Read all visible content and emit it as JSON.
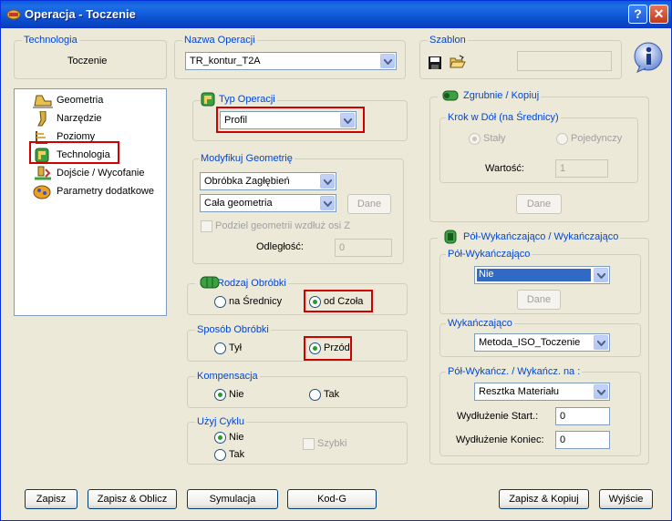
{
  "window": {
    "title": "Operacja - Toczenie",
    "help_label": "?",
    "close_label": "✕"
  },
  "technologia": {
    "legend": "Technologia",
    "value": "Toczenie"
  },
  "nazwa_operacji": {
    "legend": "Nazwa Operacji",
    "value": "TR_kontur_T2A"
  },
  "szablon": {
    "legend": "Szablon",
    "value": ""
  },
  "tree": {
    "items": [
      {
        "label": "Geometria",
        "icon": "geometry-icon"
      },
      {
        "label": "Narzędzie",
        "icon": "tool-icon"
      },
      {
        "label": "Poziomy",
        "icon": "levels-icon"
      },
      {
        "label": "Technologia",
        "icon": "technology-icon"
      },
      {
        "label": "Dojście / Wycofanie",
        "icon": "approach-icon"
      },
      {
        "label": "Parametry dodatkowe",
        "icon": "params-icon"
      }
    ]
  },
  "typ_operacji": {
    "legend": "Typ Operacji",
    "value": "Profil"
  },
  "modyfikuj": {
    "legend": "Modyfikuj Geometrię",
    "combo1": "Obróbka Zagłębień",
    "combo2": "Cała geometria",
    "dane_label": "Dane",
    "check_label": "Podziel geometrii wzdłuż osi Z",
    "odleglosc_label": "Odległość:",
    "odleglosc_value": "0"
  },
  "rodzaj": {
    "legend": "Rodzaj Obróbki",
    "opt1": "na Średnicy",
    "opt2": "od Czoła"
  },
  "sposob": {
    "legend": "Sposób Obróbki",
    "opt1": "Tył",
    "opt2": "Przód"
  },
  "kompensacja": {
    "legend": "Kompensacja",
    "opt1": "Nie",
    "opt2": "Tak"
  },
  "uzyj_cyklu": {
    "legend": "Użyj Cyklu",
    "opt1": "Nie",
    "opt2": "Tak",
    "check_label": "Szybki"
  },
  "zgrubnie": {
    "legend": "Zgrubnie / Kopiuj",
    "krok_legend": "Krok w Dół (na Średnicy)",
    "opt1": "Stały",
    "opt2": "Pojedynczy",
    "wartosc_label": "Wartość:",
    "wartosc_value": "1",
    "dane_label": "Dane"
  },
  "polwyk": {
    "legend": "Pół-Wykańczająco / Wykańczająco",
    "pol_legend": "Pół-Wykańczająco",
    "pol_value": "Nie",
    "dane_label": "Dane",
    "wyk_legend": "Wykańczająco",
    "wyk_value": "Metoda_ISO_Toczenie",
    "na_legend": "Pół-Wykańcz. / Wykańcz. na :",
    "na_value": "Resztka Materiału",
    "start_label": "Wydłużenie Start.:",
    "start_value": "0",
    "koniec_label": "Wydłużenie Koniec:",
    "koniec_value": "0"
  },
  "buttons": {
    "zapisz": "Zapisz",
    "zapisz_oblicz": "Zapisz & Oblicz",
    "symulacja": "Symulacja",
    "kodg": "Kod-G",
    "zapisz_kopiuj": "Zapisz & Kopiuj",
    "wyjscie": "Wyjście"
  },
  "colors": {
    "highlight": "#d00000",
    "titlebar": "#0a4fd0",
    "legend": "#0046d5"
  }
}
